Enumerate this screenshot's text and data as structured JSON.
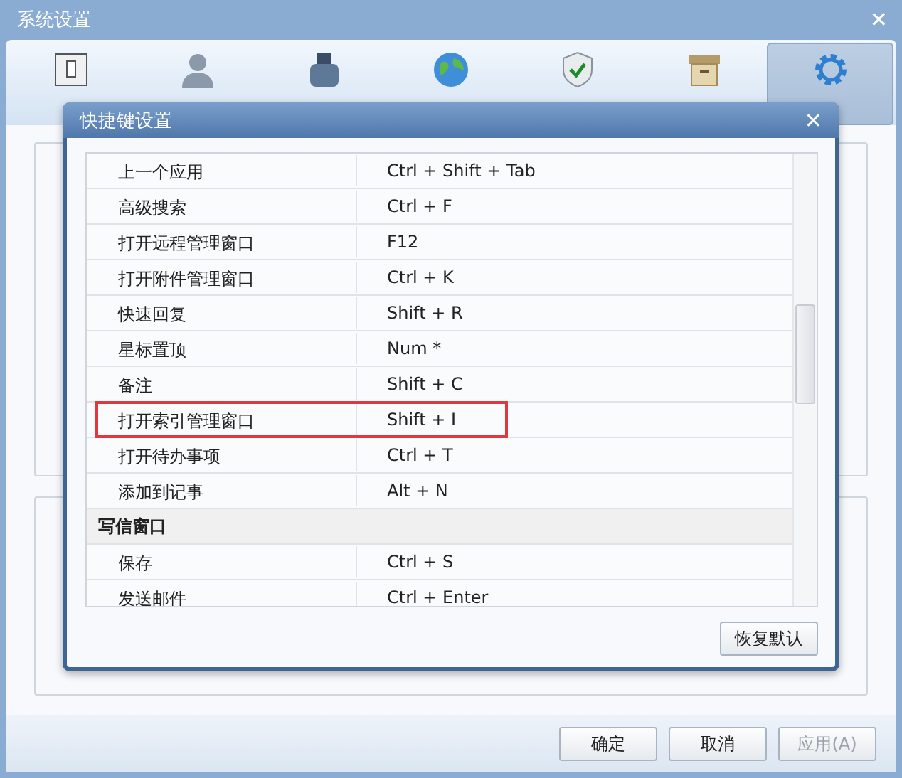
{
  "window": {
    "title": "系统设置",
    "close": "✕"
  },
  "tabs": [
    {
      "kind": "device",
      "selected": false
    },
    {
      "kind": "person",
      "selected": false
    },
    {
      "kind": "ink",
      "selected": false
    },
    {
      "kind": "globe",
      "selected": false
    },
    {
      "kind": "shield",
      "selected": false
    },
    {
      "kind": "box",
      "selected": false
    },
    {
      "kind": "gear",
      "selected": true
    }
  ],
  "dialog": {
    "title": "快捷键设置",
    "close": "✕",
    "rows": [
      {
        "kind": "shortcut",
        "action": "上一个应用",
        "keys": "Ctrl + Shift + Tab",
        "highlighted": false
      },
      {
        "kind": "shortcut",
        "action": "高级搜索",
        "keys": "Ctrl + F",
        "highlighted": false
      },
      {
        "kind": "shortcut",
        "action": "打开远程管理窗口",
        "keys": "F12",
        "highlighted": false
      },
      {
        "kind": "shortcut",
        "action": "打开附件管理窗口",
        "keys": "Ctrl + K",
        "highlighted": false
      },
      {
        "kind": "shortcut",
        "action": "快速回复",
        "keys": "Shift + R",
        "highlighted": false
      },
      {
        "kind": "shortcut",
        "action": "星标置顶",
        "keys": "Num *",
        "highlighted": false
      },
      {
        "kind": "shortcut",
        "action": "备注",
        "keys": "Shift + C",
        "highlighted": false
      },
      {
        "kind": "shortcut",
        "action": "打开索引管理窗口",
        "keys": "Shift + I",
        "highlighted": true
      },
      {
        "kind": "shortcut",
        "action": "打开待办事项",
        "keys": "Ctrl + T",
        "highlighted": false
      },
      {
        "kind": "shortcut",
        "action": "添加到记事",
        "keys": "Alt + N",
        "highlighted": false
      },
      {
        "kind": "section",
        "action": "写信窗口"
      },
      {
        "kind": "shortcut",
        "action": "保存",
        "keys": "Ctrl + S",
        "highlighted": false
      },
      {
        "kind": "shortcut",
        "action": "发送邮件",
        "keys": "Ctrl + Enter",
        "highlighted": false
      }
    ],
    "restore_button": "恢复默认"
  },
  "buttons": [
    {
      "label": "确定",
      "disabled": false
    },
    {
      "label": "取消",
      "disabled": false
    },
    {
      "label": "应用(A)",
      "disabled": true
    }
  ]
}
